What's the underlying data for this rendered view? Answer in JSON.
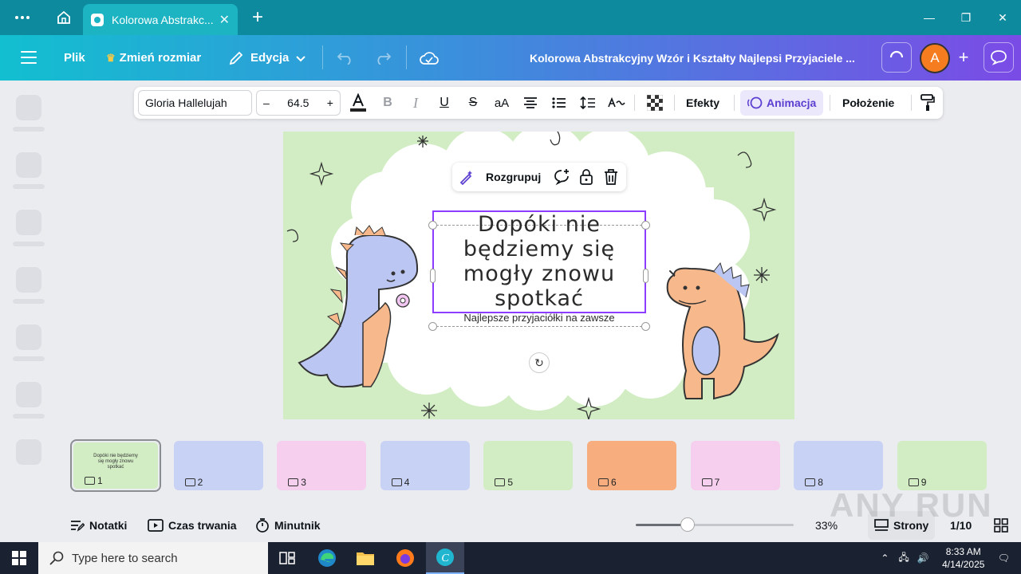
{
  "browser": {
    "tab_title": "Kolorowa Abstrakc...",
    "window_controls": [
      "minimize",
      "maximize",
      "close"
    ]
  },
  "app_bar": {
    "file_label": "Plik",
    "resize_label": "Zmień rozmiar",
    "edit_label": "Edycja",
    "document_title": "Kolorowa Abstrakcyjny Wzór i Kształty Najlepsi Przyjaciele ...",
    "avatar_letter": "A"
  },
  "text_toolbar": {
    "font_name": "Gloria Hallelujah",
    "font_size": "64.5",
    "decrease": "–",
    "increase": "+",
    "case_label": "aA",
    "effects_label": "Efekty",
    "animation_label": "Animacja",
    "position_label": "Położenie"
  },
  "context_menu": {
    "ungroup_label": "Rozgrupuj"
  },
  "slide": {
    "heading": "Dopóki nie będziemy się mogły znowu spotkać",
    "subtitle": "Najlepsze przyjaciółki na zawsze"
  },
  "thumbnails": [
    {
      "num": "1",
      "bg": "#d2edc4",
      "text": "Dopóki nie będziemy się mogły znowu spotkać",
      "selected": true
    },
    {
      "num": "2",
      "bg": "#c8d2f5",
      "text": "",
      "selected": false
    },
    {
      "num": "3",
      "bg": "#f6cfee",
      "text": "",
      "selected": false
    },
    {
      "num": "4",
      "bg": "#c8d2f5",
      "text": "",
      "selected": false
    },
    {
      "num": "5",
      "bg": "#d2edc4",
      "text": "",
      "selected": false
    },
    {
      "num": "6",
      "bg": "#f7ad7e",
      "text": "",
      "selected": false
    },
    {
      "num": "7",
      "bg": "#f6cfee",
      "text": "",
      "selected": false
    },
    {
      "num": "8",
      "bg": "#c8d2f5",
      "text": "",
      "selected": false
    },
    {
      "num": "9",
      "bg": "#d2edc4",
      "text": "",
      "selected": false
    }
  ],
  "bottom_bar": {
    "notes_label": "Notatki",
    "duration_label": "Czas trwania",
    "timer_label": "Minutnik",
    "zoom": "33%",
    "zoom_fraction": 0.33,
    "pages_label": "Strony",
    "page_counter": "1/10"
  },
  "taskbar": {
    "search_placeholder": "Type here to search",
    "time": "8:33 AM",
    "date": "4/14/2025"
  },
  "watermark": "ANY RUN",
  "colors": {
    "accent": "#8b3dff",
    "slide_bg": "#d2edc4",
    "avatar": "#f57c1f",
    "browser_bar": "#0e8a9e"
  }
}
